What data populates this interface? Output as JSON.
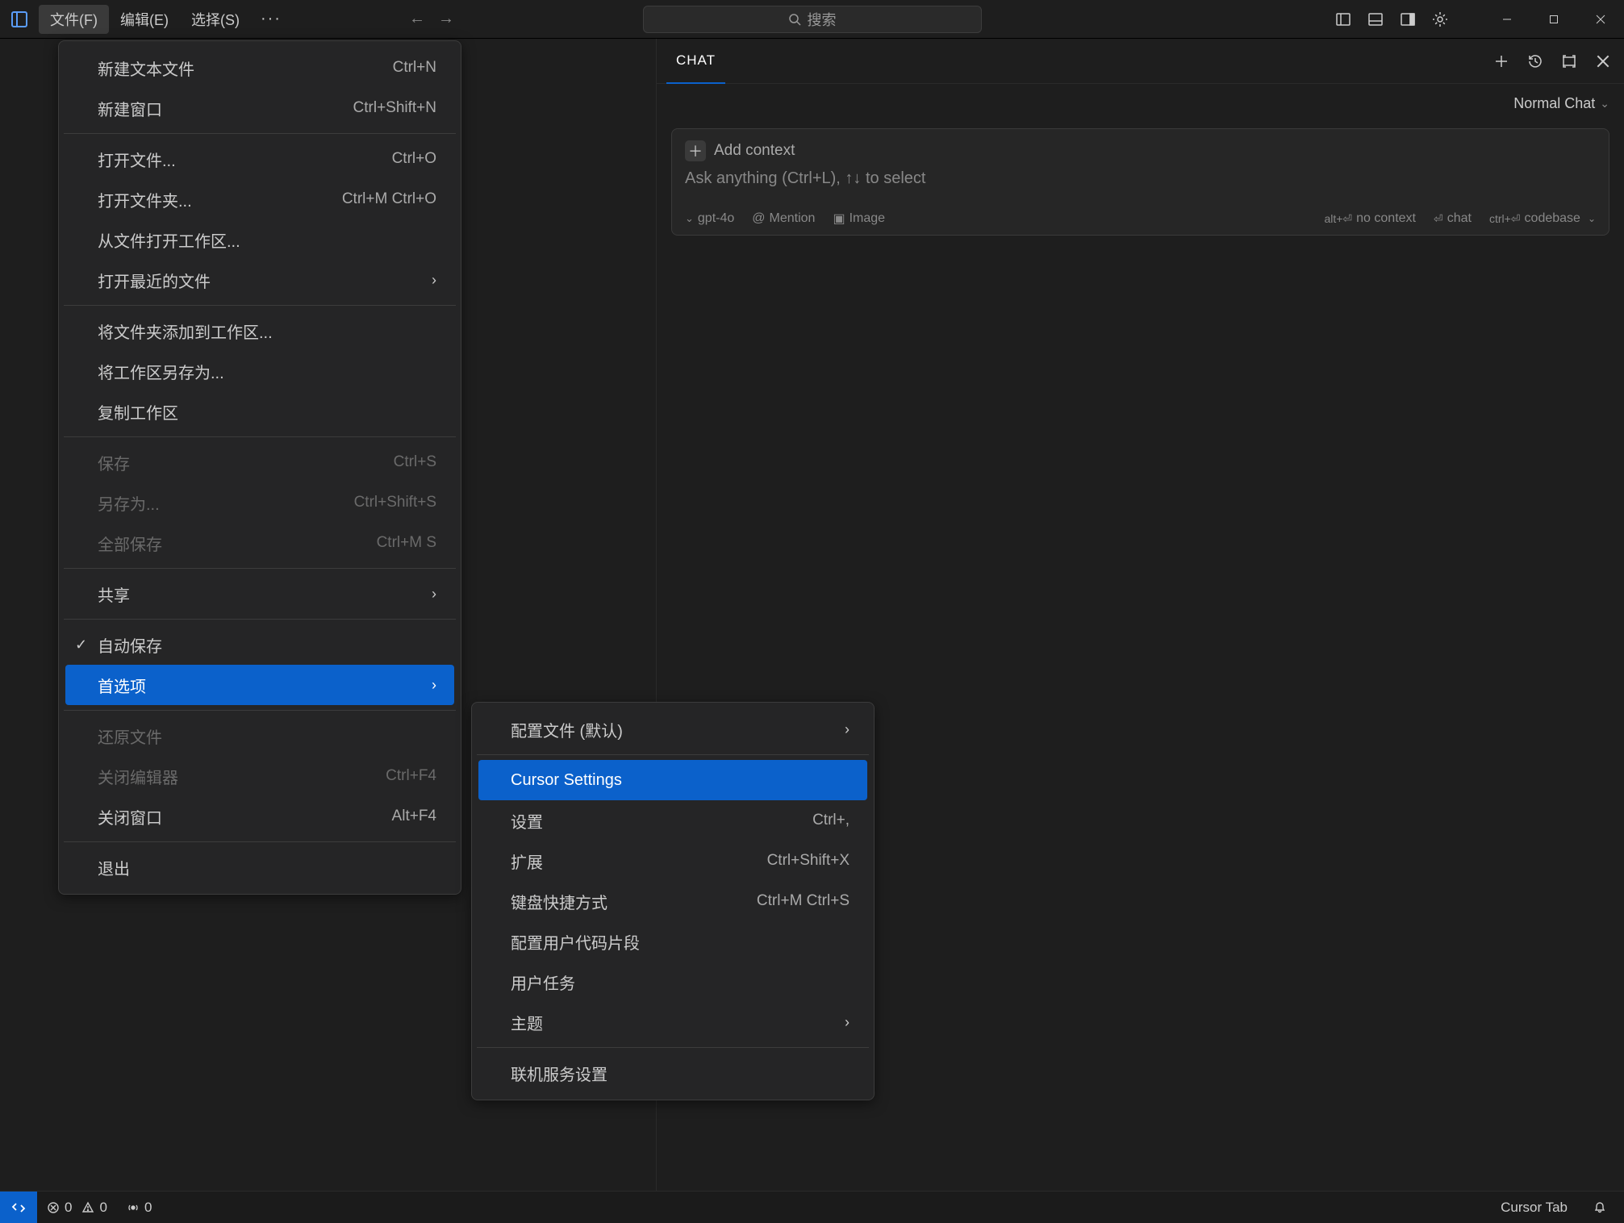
{
  "menubar": {
    "file": "文件(F)",
    "edit": "编辑(E)",
    "select": "选择(S)"
  },
  "search_placeholder": "搜索",
  "file_menu": {
    "new_text_file": {
      "label": "新建文本文件",
      "shortcut": "Ctrl+N"
    },
    "new_window": {
      "label": "新建窗口",
      "shortcut": "Ctrl+Shift+N"
    },
    "open_file": {
      "label": "打开文件...",
      "shortcut": "Ctrl+O"
    },
    "open_folder": {
      "label": "打开文件夹...",
      "shortcut": "Ctrl+M Ctrl+O"
    },
    "open_workspace_from_file": {
      "label": "从文件打开工作区..."
    },
    "open_recent": {
      "label": "打开最近的文件"
    },
    "add_folder_to_workspace": {
      "label": "将文件夹添加到工作区..."
    },
    "save_workspace_as": {
      "label": "将工作区另存为..."
    },
    "duplicate_workspace": {
      "label": "复制工作区"
    },
    "save": {
      "label": "保存",
      "shortcut": "Ctrl+S"
    },
    "save_as": {
      "label": "另存为...",
      "shortcut": "Ctrl+Shift+S"
    },
    "save_all": {
      "label": "全部保存",
      "shortcut": "Ctrl+M S"
    },
    "share": {
      "label": "共享"
    },
    "autosave": {
      "label": "自动保存"
    },
    "preferences": {
      "label": "首选项"
    },
    "revert_file": {
      "label": "还原文件"
    },
    "close_editor": {
      "label": "关闭编辑器",
      "shortcut": "Ctrl+F4"
    },
    "close_window": {
      "label": "关闭窗口",
      "shortcut": "Alt+F4"
    },
    "exit": {
      "label": "退出"
    }
  },
  "prefs_menu": {
    "profiles": {
      "label": "配置文件 (默认)"
    },
    "cursor_settings": {
      "label": "Cursor Settings"
    },
    "settings": {
      "label": "设置",
      "shortcut": "Ctrl+,"
    },
    "extensions": {
      "label": "扩展",
      "shortcut": "Ctrl+Shift+X"
    },
    "keyboard_shortcuts": {
      "label": "键盘快捷方式",
      "shortcut": "Ctrl+M Ctrl+S"
    },
    "user_snippets": {
      "label": "配置用户代码片段"
    },
    "user_tasks": {
      "label": "用户任务"
    },
    "theme": {
      "label": "主题"
    },
    "online_services": {
      "label": "联机服务设置"
    }
  },
  "chat": {
    "tab": "CHAT",
    "mode": "Normal Chat",
    "add_context": "Add context",
    "prompt_placeholder": "Ask anything (Ctrl+L), ↑↓ to select",
    "model": "gpt-4o",
    "mention": "Mention",
    "image": "Image",
    "hint_no_context_key": "alt+⏎",
    "hint_no_context": "no context",
    "hint_chat_key": "⏎",
    "hint_chat": "chat",
    "hint_codebase_key": "ctrl+⏎",
    "hint_codebase": "codebase"
  },
  "statusbar": {
    "errors": "0",
    "warnings": "0",
    "ports": "0",
    "cursor_tab": "Cursor Tab"
  }
}
